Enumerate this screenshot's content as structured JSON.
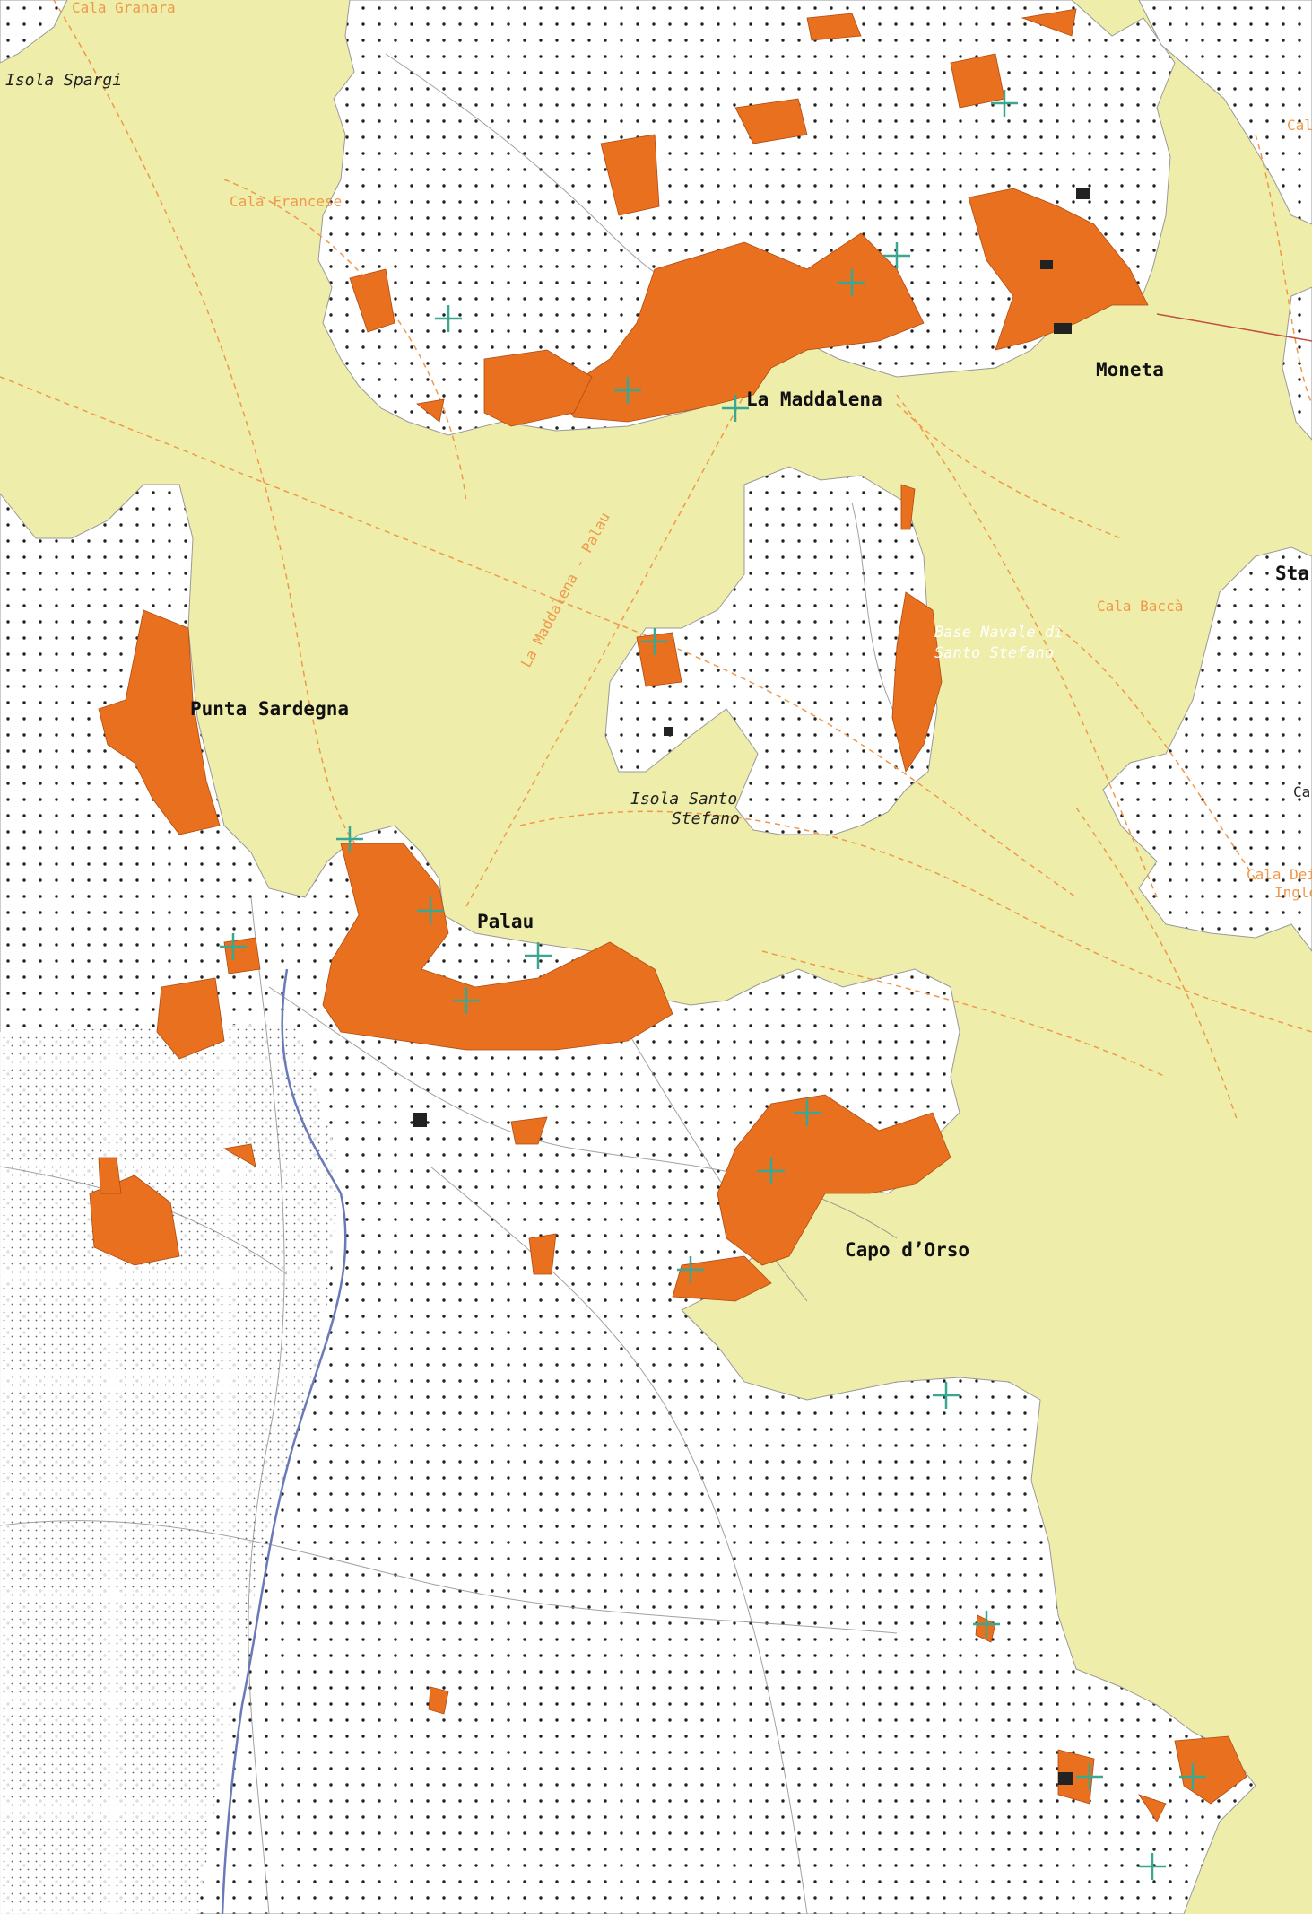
{
  "colors": {
    "sea": "#eeeeaa",
    "land": "#ffffff",
    "urban": "#e8701e",
    "dots": "#222222",
    "ferry": "#f0984a",
    "marker": "#3aa890",
    "river": "#6a7ab8"
  },
  "labels": {
    "la_maddalena": "La Maddalena",
    "moneta": "Moneta",
    "punta_sardegna": "Punta Sardegna",
    "palau": "Palau",
    "capo_dorso": "Capo d’Orso",
    "sta": "Sta",
    "isola_spargi": "Isola Spargi",
    "isola_santo_stefano_1": "Isola Santo",
    "isola_santo_stefano_2": "Stefano",
    "cala_granara": "Cala Granara",
    "cala_francese": "Cala Francese",
    "cala_bacca": "Cala Baccà",
    "cala_right_top": "Cal",
    "cala_right_mid": "Ca",
    "cala_dei_inglesi_1": "Cala Dei",
    "cala_dei_inglesi_2": "Ingle",
    "ferry_route": "La Maddalena - Palau",
    "base_navale_1": "Base Navale di",
    "base_navale_2": "Santo Stefano"
  },
  "icons": [
    "port-marker-icon"
  ]
}
